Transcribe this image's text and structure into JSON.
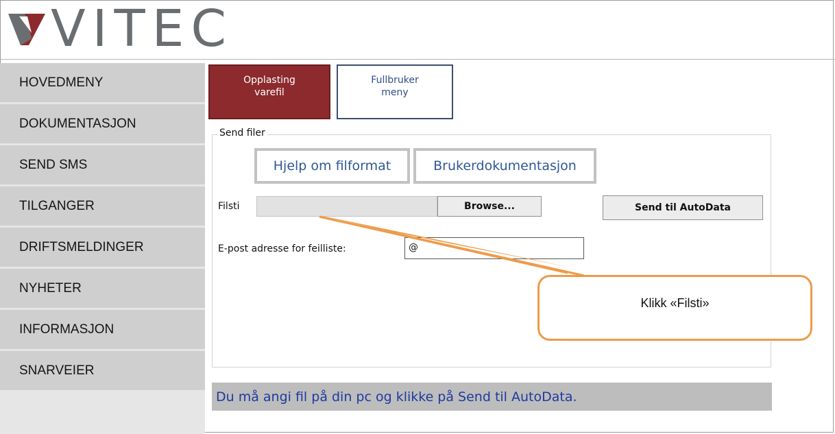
{
  "brand": {
    "name": "VITEC"
  },
  "sidebar": {
    "items": [
      {
        "label": "HOVEDMENY"
      },
      {
        "label": "DOKUMENTASJON"
      },
      {
        "label": "SEND SMS"
      },
      {
        "label": "TILGANGER"
      },
      {
        "label": "DRIFTSMELDINGER"
      },
      {
        "label": "NYHETER"
      },
      {
        "label": "INFORMASJON"
      },
      {
        "label": "SNARVEIER"
      }
    ]
  },
  "tabs": [
    {
      "label_line1": "Opplasting",
      "label_line2": "varefil",
      "active": true
    },
    {
      "label_line1": "Fullbruker",
      "label_line2": "meny",
      "active": false
    }
  ],
  "form": {
    "legend": "Send filer",
    "help_link": "Hjelp om filformat",
    "docs_link": "Brukerdokumentasjon",
    "file_label": "Filsti",
    "browse_button": "Browse...",
    "send_button": "Send til AutoData",
    "email_label": "E-post adresse for feilliste:",
    "email_value": "@"
  },
  "status_message": "Du må angi fil på din pc og klikke på Send til AutoData.",
  "callout": {
    "text": "Klikk «Filsti»"
  },
  "colors": {
    "accent": "#8c2a2d",
    "link": "#2f5894",
    "callout_border": "#ee9a4a",
    "status_text": "#1f3a9e"
  }
}
